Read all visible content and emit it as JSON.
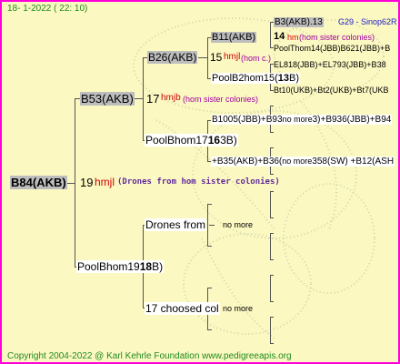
{
  "header": {
    "date": "18-   1-2022  (  22:  10)"
  },
  "footer": {
    "copyright": "Copyright 2004-2022 @ Karl Kehrle Foundation   www.pedigreeapis.org"
  },
  "colors": {
    "border": "#ff00d8",
    "background": "#fcf8c2",
    "highlight": "#bdbdbd"
  },
  "root": {
    "name": "B84(AKB)",
    "generation": "19",
    "hmj": "hmjl",
    "note": "(Drones from hom sister colonies)"
  },
  "gen1": {
    "father": "B53(AKB)",
    "father_gen": "17",
    "father_hmj": "hmjb",
    "father_note": "(hom sister colonies)",
    "mother": "PoolBhom19",
    "mother_suffix": "18",
    "mother_tail": "B)"
  },
  "gen2": {
    "ff": "B26(AKB)",
    "ff_gen": "15",
    "ff_hmj": "hmjl",
    "ff_note": "(hom c.)",
    "fm": "PoolBhom17",
    "fm_suffix": "16",
    "fm_tail": "3B)",
    "mf": "Drones from",
    "mf_note": "no more",
    "mm": "17 choosed col",
    "mm_note": "no more"
  },
  "gen3": {
    "fff": "B11(AKB)",
    "fff_gen": "14",
    "fff_hmj": "hm",
    "fff_note": "(hom sister colonies)",
    "ffm": "PoolB2hom15(",
    "ffm_suffix": "13",
    "ffm_tail": "B)",
    "fmf": "B1005(JBB)+B93",
    "fmf_mid": "no more",
    "fmf_tail": "3)+B936(JBB)+B94",
    "fmm": "+B35(AKB)+B36(",
    "fmm_mid": "no more",
    "fmm_tail": "358(SW) +B12(ASH"
  },
  "gen4": {
    "a": "B3(AKB).13",
    "a2": "G29 - Sinop62R",
    "b": "PoolThom14(JBB)",
    "b_mid": "B621(JBB)+B",
    "c": "EL818(JBB)+EL793(JBB)+B38",
    "d": "Bt10(UKB)+Bt2(UKB)+Bt7(UKB"
  }
}
